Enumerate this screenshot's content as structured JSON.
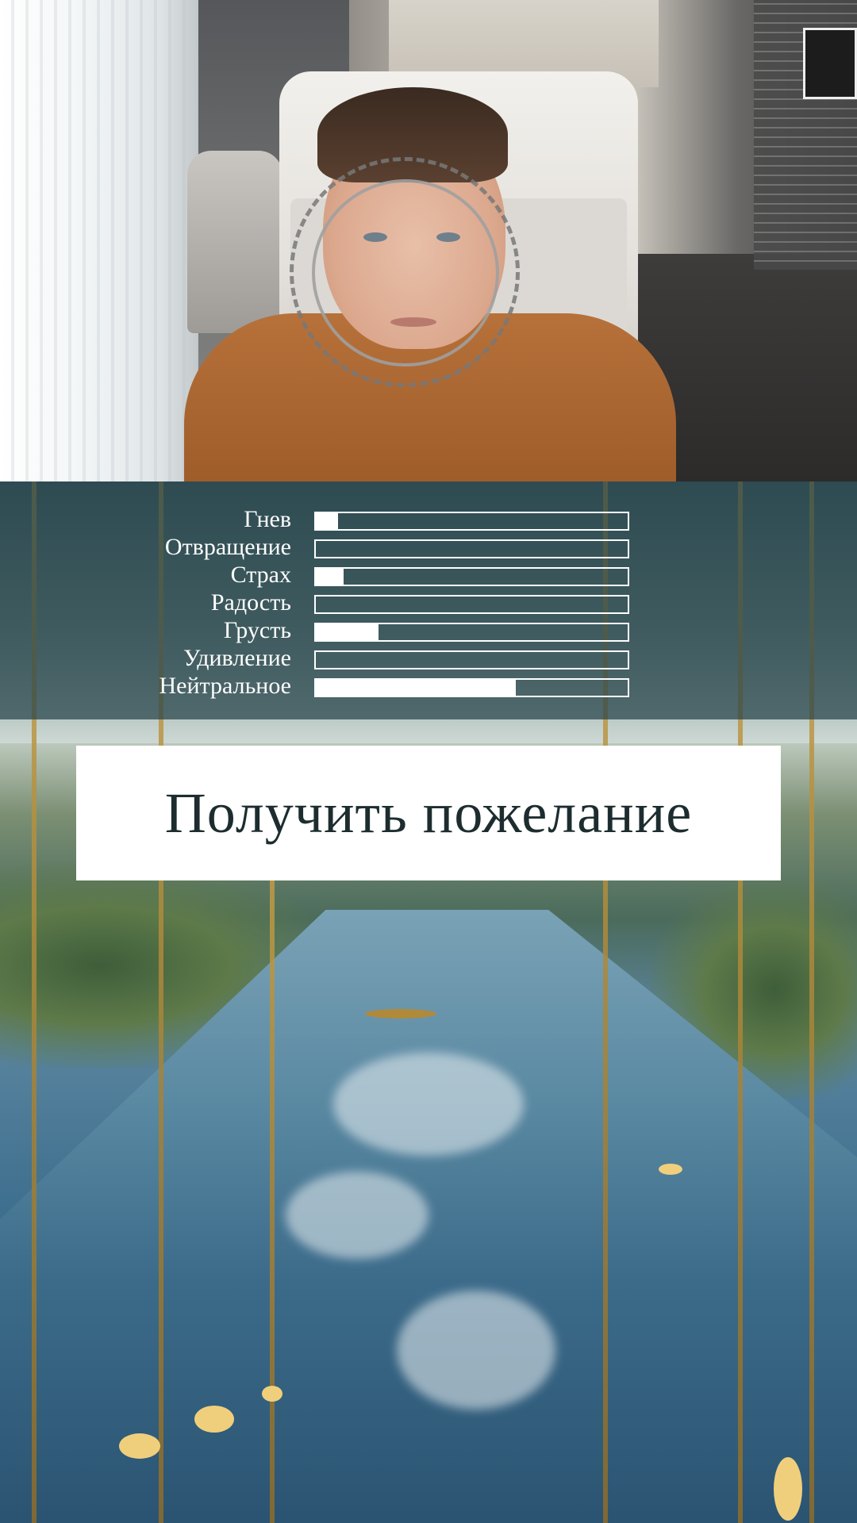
{
  "camera": {
    "overlay_rings": [
      "dashed",
      "solid"
    ]
  },
  "emotions": [
    {
      "label": "Гнев",
      "level": 0.07
    },
    {
      "label": "Отвращение",
      "level": 0.0
    },
    {
      "label": "Страх",
      "level": 0.09
    },
    {
      "label": "Радость",
      "level": 0.0
    },
    {
      "label": "Грусть",
      "level": 0.2
    },
    {
      "label": "Удивление",
      "level": 0.0
    },
    {
      "label": "Нейтральное",
      "level": 0.64
    }
  ],
  "wish_button": {
    "label": "Получить пожелание"
  },
  "colors": {
    "panel_bg": "#26424a",
    "bar_color": "#ffffff",
    "button_bg": "#ffffff",
    "button_text": "#1d2d2f"
  }
}
